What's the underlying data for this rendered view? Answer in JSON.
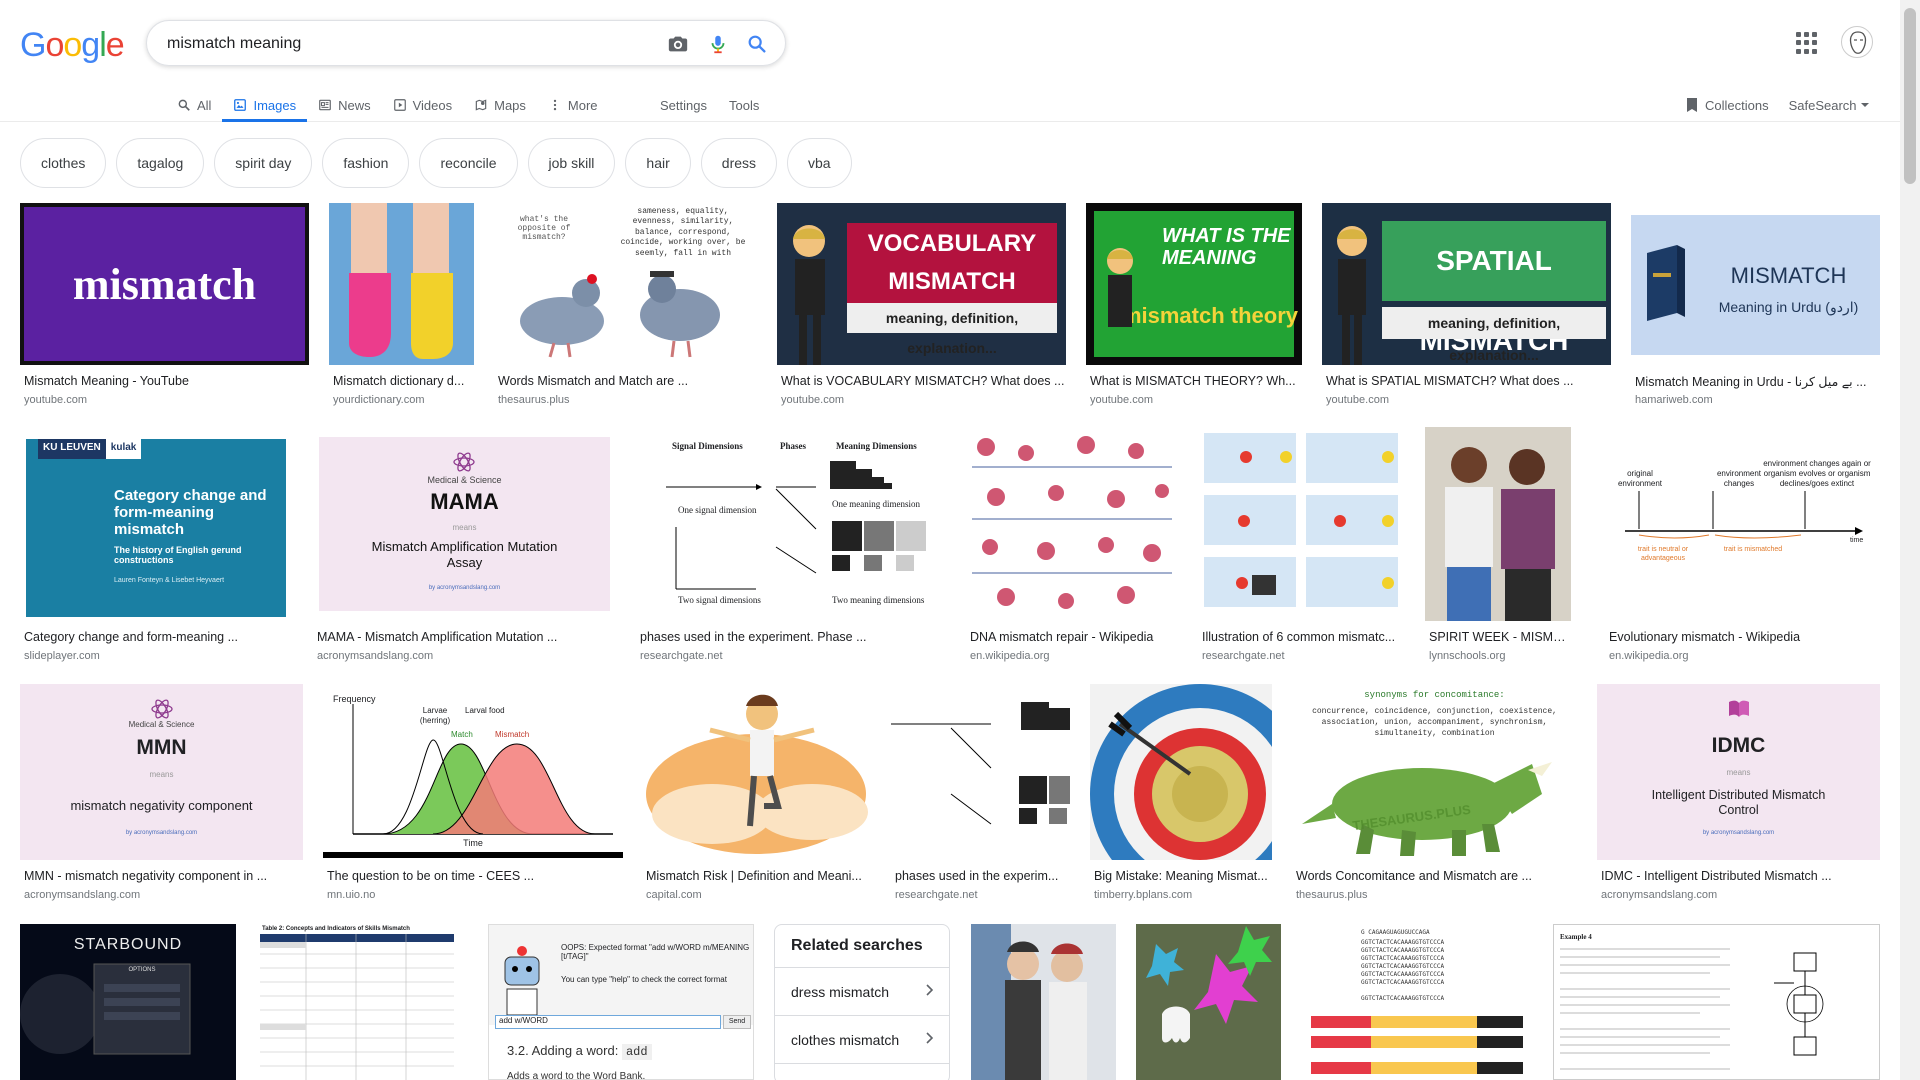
{
  "header": {
    "search_query": "mismatch meaning",
    "logo": [
      "G",
      "o",
      "o",
      "g",
      "l",
      "e"
    ],
    "logo_colors": [
      "#4285f4",
      "#ea4335",
      "#fbbc05",
      "#4285f4",
      "#34a853",
      "#ea4335"
    ]
  },
  "tabs": [
    {
      "label": "All",
      "icon": "search-icon",
      "active": false
    },
    {
      "label": "Images",
      "icon": "image-icon",
      "active": true
    },
    {
      "label": "News",
      "icon": "news-icon",
      "active": false
    },
    {
      "label": "Videos",
      "icon": "video-icon",
      "active": false
    },
    {
      "label": "Maps",
      "icon": "map-icon",
      "active": false
    },
    {
      "label": "More",
      "icon": "more-vertical-icon",
      "active": false
    }
  ],
  "tools": {
    "settings": "Settings",
    "tools": "Tools"
  },
  "right_options": {
    "collections": "Collections",
    "safesearch": "SafeSearch"
  },
  "chips": [
    "clothes",
    "tagalog",
    "spirit day",
    "fashion",
    "reconcile",
    "job skill",
    "hair",
    "dress",
    "vba"
  ],
  "results_row1": [
    {
      "caption": "Mismatch Meaning - YouTube",
      "source": "youtube.com",
      "thumb_text": "mismatch"
    },
    {
      "caption": "Mismatch dictionary d...",
      "source": "yourdictionary.com"
    },
    {
      "caption": "Words Mismatch and Match are ...",
      "source": "thesaurus.plus",
      "thumb_text": "what's the opposite of mismatch?",
      "thumb_text2": "sameness, equality, evenness, similarity, balance, correspond, coincide, working over, be seemly, fall in with"
    },
    {
      "caption": "What is VOCABULARY MISMATCH? What does ...",
      "source": "youtube.com",
      "thumb_text": "VOCABULARY MISMATCH",
      "thumb_text2": "meaning, definition, explanation..."
    },
    {
      "caption": "What is MISMATCH THEORY? Wh...",
      "source": "youtube.com",
      "thumb_text": "WHAT IS THE MEANING",
      "thumb_text2": "mismatch theory"
    },
    {
      "caption": "What is SPATIAL MISMATCH? What does ...",
      "source": "youtube.com",
      "thumb_text": "SPATIAL MISMATCH",
      "thumb_text2": "meaning, definition, explanation..."
    },
    {
      "caption": "Mismatch Meaning in Urdu - بے میل کرنا ...",
      "source": "hamariweb.com",
      "thumb_text": "MISMATCH",
      "thumb_text2": "Meaning in Urdu (اردو)"
    }
  ],
  "results_row2": [
    {
      "caption": "Category change and form-meaning ...",
      "source": "slideplayer.com",
      "thumb_text": "Category change and form-meaning mismatch",
      "thumb_text2": "The history of English gerund constructions",
      "thumb_text3": "Lauren Fonteyn & Lisebet Heyvaert",
      "badge1": "KU LEUVEN",
      "badge2": "kulak"
    },
    {
      "caption": "MAMA - Mismatch Amplification Mutation ...",
      "source": "acronymsandslang.com",
      "thumb_text": "MAMA",
      "thumb_text2": "Mismatch Amplification Mutation Assay",
      "thumb_label": "Medical & Science",
      "thumb_means": "means",
      "thumb_site": "by acronymsandslang.com"
    },
    {
      "caption": "phases used in the experiment. Phase ...",
      "source": "researchgate.net",
      "thumb_text": "Signal Dimensions",
      "thumb_text2": "Meaning Dimensions",
      "thumb_phases": "Phases",
      "thumb_one_signal": "One signal dimension",
      "thumb_two_signal": "Two signal dimensions",
      "thumb_one_meaning": "One meaning dimension",
      "thumb_two_meaning": "Two meaning dimensions"
    },
    {
      "caption": "DNA mismatch repair - Wikipedia",
      "source": "en.wikipedia.org"
    },
    {
      "caption": "Illustration of 6 common mismatc...",
      "source": "researchgate.net"
    },
    {
      "caption": "SPIRIT WEEK - MISMAT...",
      "source": "lynnschools.org"
    },
    {
      "caption": "Evolutionary mismatch - Wikipedia",
      "source": "en.wikipedia.org",
      "thumb_text": "original environment",
      "thumb_text2": "environment changes",
      "thumb_text3": "environment changes again or organism evolves or organism declines/goes extinct",
      "thumb_neutral": "trait is neutral or advantageous",
      "thumb_mismatched": "trait is mismatched",
      "thumb_time": "time"
    }
  ],
  "results_row3": [
    {
      "caption": "MMN - mismatch negativity component in ...",
      "source": "acronymsandslang.com",
      "thumb_text": "MMN",
      "thumb_text2": "mismatch negativity component",
      "thumb_label": "Medical & Science",
      "thumb_means": "means",
      "thumb_site": "by acronymsandslang.com"
    },
    {
      "caption": "The question to be on time - CEES ...",
      "source": "mn.uio.no",
      "thumb_text": "Frequency",
      "thumb_text2": "Time",
      "thumb_larvae": "Larvae (herring)",
      "thumb_food": "Larval food",
      "thumb_match": "Match",
      "thumb_mismatch": "Mismatch"
    },
    {
      "caption": "Mismatch Risk | Definition and Meani...",
      "source": "capital.com"
    },
    {
      "caption": "phases used in the experim...",
      "source": "researchgate.net"
    },
    {
      "caption": "Big Mistake: Meaning Mismat...",
      "source": "timberry.bplans.com"
    },
    {
      "caption": "Words Concomitance and Mismatch are ...",
      "source": "thesaurus.plus",
      "thumb_text": "synonyms for concomitance:",
      "thumb_text2": "concurrence, coincidence, conjunction, coexistence, association, union, accompaniment, synchronism, simultaneity, combination",
      "thumb_watermark": "THESAURUS.PLUS"
    },
    {
      "caption": "IDMC - Intelligent Distributed Mismatch ...",
      "source": "acronymsandslang.com",
      "thumb_text": "IDMC",
      "thumb_text2": "Intelligent Distributed Mismatch Control",
      "thumb_means": "means",
      "thumb_site": "by acronymsandslang.com"
    }
  ],
  "results_row4": {
    "starbound": "STARBOUND",
    "starbound_menu": "OPTIONS",
    "table_title": "Table 2: Concepts and Indicators of Skills Mismatch",
    "oops_text": "OOPS: Expected format \"add w/WORD m/MEANING [t/TAG]\"",
    "oops_help": "You can type \"help\" to check the correct format",
    "oops_input": "add w/WORD",
    "oops_send": "Send",
    "oops_heading": "3.2. Adding a word:",
    "oops_code": "add",
    "oops_desc": "Adds a word to the Word Bank.",
    "example_title": "Example 4"
  },
  "related": {
    "title": "Related searches",
    "items": [
      "dress mismatch",
      "clothes mismatch"
    ]
  }
}
